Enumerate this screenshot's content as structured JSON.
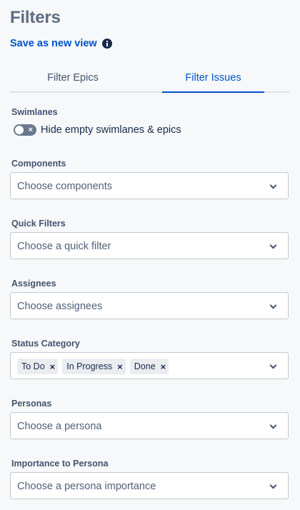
{
  "panel": {
    "title": "Filters",
    "save_view_label": "Save as new view"
  },
  "tabs": [
    {
      "label": "Filter Epics"
    },
    {
      "label": "Filter Issues"
    }
  ],
  "swimlanes": {
    "label": "Swimlanes",
    "toggle_label": "Hide empty swimlanes & epics",
    "toggle_on": false
  },
  "components": {
    "label": "Components",
    "placeholder": "Choose components"
  },
  "quick_filters": {
    "label": "Quick Filters",
    "placeholder": "Choose a quick filter"
  },
  "assignees": {
    "label": "Assignees",
    "placeholder": "Choose assignees"
  },
  "status_category": {
    "label": "Status Category",
    "selected": [
      "To Do",
      "In Progress",
      "Done"
    ]
  },
  "personas": {
    "label": "Personas",
    "placeholder": "Choose a persona"
  },
  "importance": {
    "label": "Importance to Persona",
    "placeholder": "Choose a persona importance"
  },
  "icons": {
    "info": "info-icon",
    "remove": "close-icon",
    "dropdown": "chevron-down-icon"
  },
  "colors": {
    "accent": "#0052cc",
    "heading": "#5e6c84",
    "text": "#172b4d"
  }
}
